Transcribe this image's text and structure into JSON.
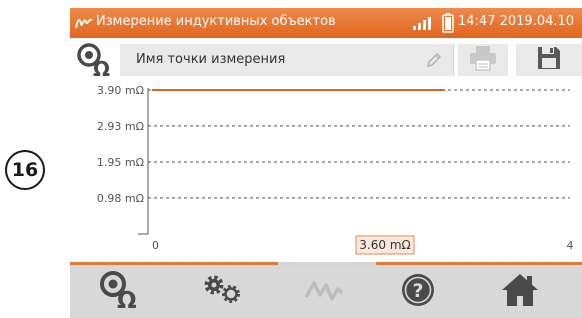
{
  "step_number": "16",
  "status_bar": {
    "title": "Измерение индуктивных объектов",
    "time": "14:47",
    "date": "2019.04.10"
  },
  "toolbar": {
    "measurement_point_name": "Имя точки измерения"
  },
  "chart_data": {
    "type": "line",
    "y_tick_labels": [
      "3.90 mΩ",
      "2.93 mΩ",
      "1.95 mΩ",
      "0.98 mΩ"
    ],
    "y_tick_values": [
      3.9,
      2.93,
      1.95,
      0.98
    ],
    "x_tick_labels": [
      "0",
      "4"
    ],
    "ylim": [
      0,
      3.9
    ],
    "xlim": [
      0,
      4
    ],
    "grid": true,
    "series": [
      {
        "x": [
          0,
          2.8
        ],
        "values": [
          3.9,
          3.9
        ],
        "color": "#e0661f"
      }
    ],
    "cursor_value_label": "3.60 mΩ"
  },
  "colors": {
    "accent": "#e0661f",
    "toolbar_bg": "#e9e9e9",
    "nav_bg": "#d8d8d8"
  },
  "icons": {
    "status_logo": "meter-logo-icon",
    "measurement_type": "inductive-measurement-icon",
    "edit": "pencil-icon",
    "print": "printer-icon",
    "save": "floppy-disk-icon",
    "nav": [
      "measurement-type-icon",
      "settings-gears-icon",
      "waveform-icon",
      "help-icon",
      "home-icon"
    ]
  }
}
